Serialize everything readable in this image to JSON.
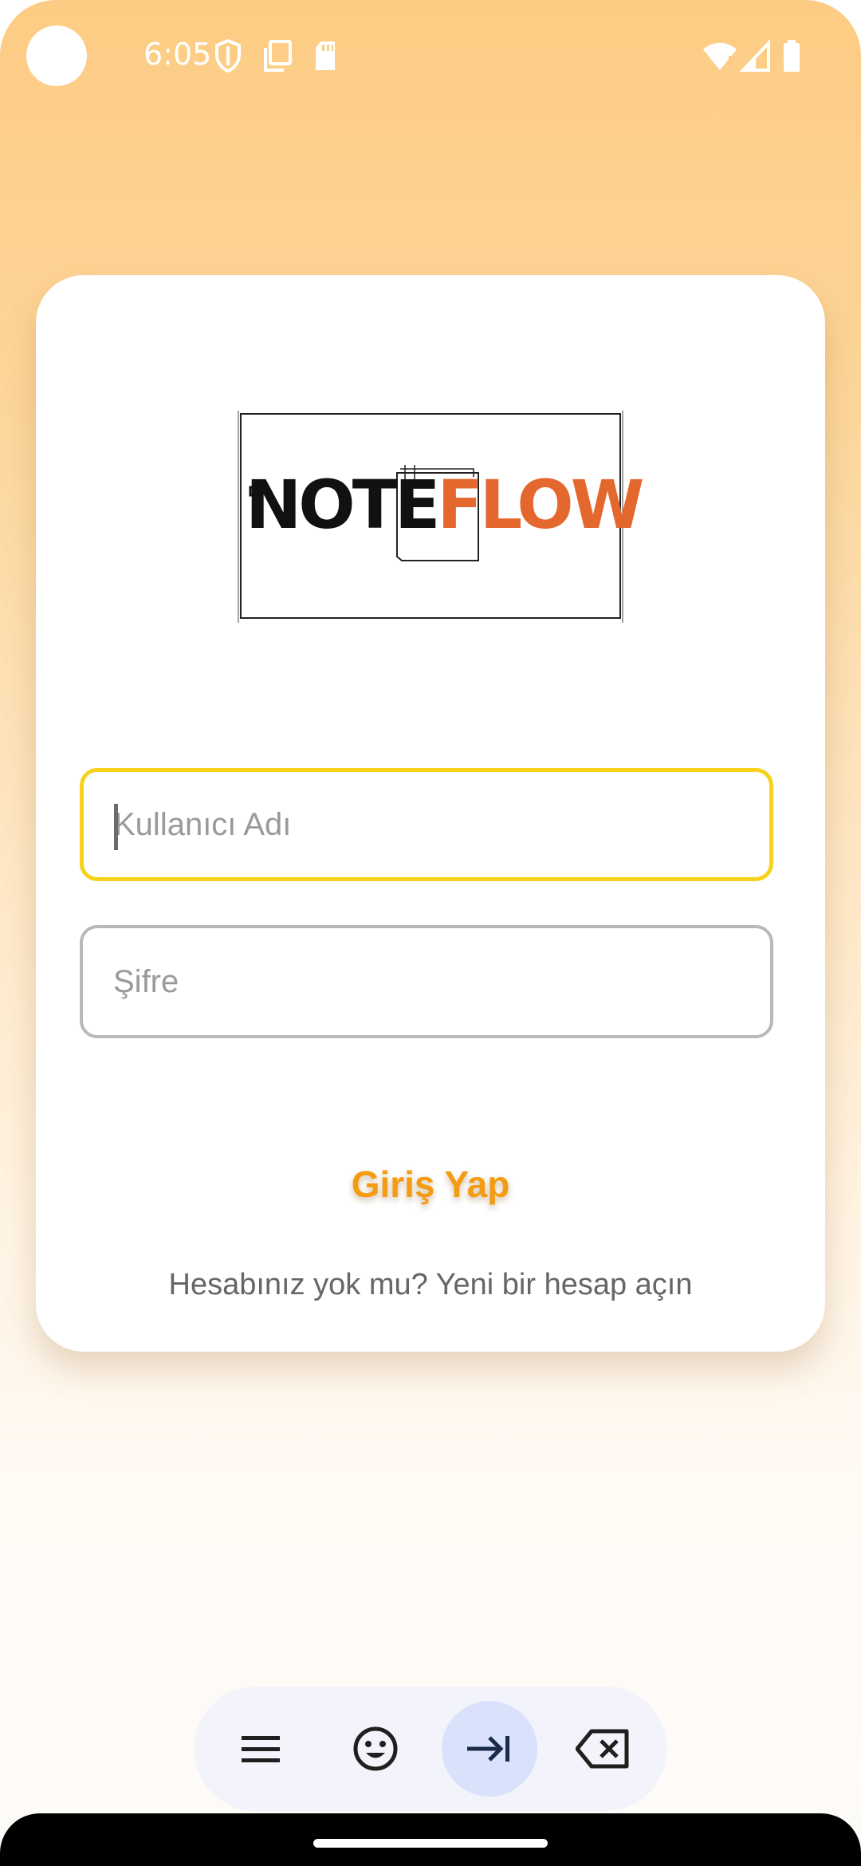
{
  "status_bar": {
    "time": "6:05",
    "left_icons": [
      "shield-icon",
      "copy-icon",
      "sd-card-icon"
    ],
    "right_icons": [
      "wifi-icon",
      "signal-icon",
      "battery-icon"
    ]
  },
  "login": {
    "logo": {
      "part1": "NOTE",
      "part2": "FLOW"
    },
    "username_placeholder": "Kullanıcı Adı",
    "password_placeholder": "Şifre",
    "login_button_label": "Giriş Yap",
    "signup_text": "Hesabınız yok mu? Yeni bir hesap açın"
  },
  "keyboard_toolbar": {
    "buttons": [
      "menu-icon",
      "emoji-icon",
      "tab-icon",
      "backspace-icon"
    ],
    "active_index": 2
  },
  "colors": {
    "background_top": "#fdcc84",
    "accent_focus": "#f7d11c",
    "button_text": "#f39c12",
    "logo_orange": "#e4672e"
  }
}
